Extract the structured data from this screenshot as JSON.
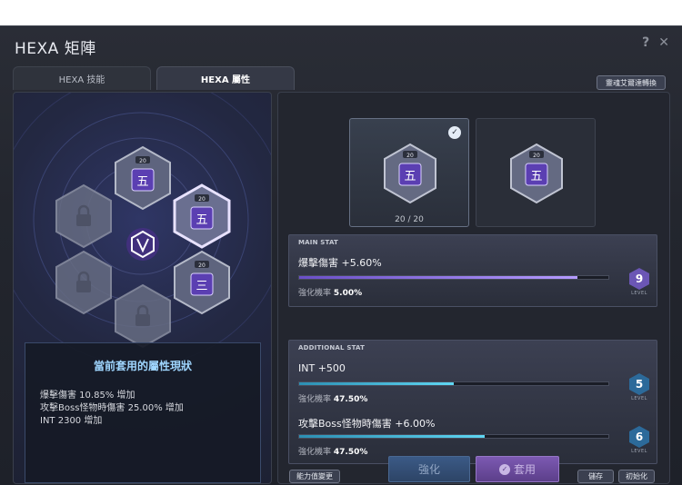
{
  "window": {
    "title": "HEXA 矩陣",
    "help_icon": "?",
    "close_icon": "✕"
  },
  "tabs": [
    {
      "label": "HEXA 技能",
      "active": false
    },
    {
      "label": "HEXA 屬性",
      "active": true
    }
  ],
  "transfer_button": "靈魂艾爾達轉換",
  "hexa_nodes": [
    {
      "level": "20",
      "glyph": "五",
      "state": "unlocked"
    },
    {
      "level": "20",
      "glyph": "五",
      "state": "selected"
    },
    {
      "level": "20",
      "glyph": "三",
      "state": "unlocked"
    },
    {
      "state": "locked"
    },
    {
      "state": "locked"
    },
    {
      "state": "locked"
    }
  ],
  "status": {
    "title": "當前套用的屬性現狀",
    "lines": [
      "爆擊傷害 10.85% 增加",
      "攻擊Boss怪物時傷害 25.00% 增加",
      "INT 2300 增加"
    ]
  },
  "slots": {
    "count": "20 / 20",
    "selected_glyph": "五",
    "alt_glyph": "五"
  },
  "main_stat": {
    "header": "MAIN STAT",
    "name": "爆擊傷害 +5.60%",
    "sub_label": "強化機率",
    "sub_value": "5.00%",
    "progress": 0.9,
    "level": "9",
    "level_label": "LEVEL"
  },
  "additional_stat": {
    "header": "ADDITIONAL STAT",
    "stats": [
      {
        "name": "INT +500",
        "sub_label": "強化機率",
        "sub_value": "47.50%",
        "progress": 0.5,
        "level": "5",
        "level_label": "LEVEL"
      },
      {
        "name": "攻擊Boss怪物時傷害 +6.00%",
        "sub_label": "強化機率",
        "sub_value": "47.50%",
        "progress": 0.6,
        "level": "6",
        "level_label": "LEVEL"
      }
    ]
  },
  "buttons": {
    "stat_change": "能力值變更",
    "enhance": "強化",
    "apply": "套用",
    "save": "儲存",
    "reset": "初始化"
  },
  "colors": {
    "accent_purple": "#b59bff",
    "accent_cyan": "#5fd6f2",
    "level_purple": "#6b56b5",
    "level_blue": "#2c6a9a"
  }
}
